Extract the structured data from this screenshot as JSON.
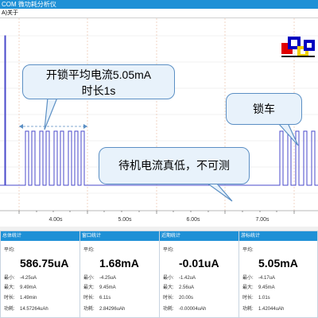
{
  "window": {
    "title": "COM 微功耗分析仪"
  },
  "menu": {
    "about": "A)关于"
  },
  "chart_data": {
    "type": "line",
    "xlabel": "",
    "ylabel": "",
    "x_ticks": [
      "4.00s",
      "5.00s",
      "6.00s",
      "7.00s"
    ],
    "annotations": {
      "callout_unlock_line1": "开锁平均电流5.05mA",
      "callout_unlock_line2": "时长1s",
      "callout_standby": "待机电流真低，不可测",
      "callout_lock": "锁车"
    }
  },
  "panels": [
    {
      "title": "总体统计",
      "avg_label": "平均:",
      "avg_value": "586.75uA",
      "rows": [
        {
          "label": "最小:",
          "value": "-4.25uA"
        },
        {
          "label": "最大:",
          "value": "9.49mA"
        },
        {
          "label": "时长:",
          "value": "1.49min"
        },
        {
          "label": "功耗:",
          "value": "14.57264uAh"
        }
      ]
    },
    {
      "title": "窗口统计",
      "avg_label": "平均:",
      "avg_value": "1.68mA",
      "rows": [
        {
          "label": "最小:",
          "value": "-4.25uA"
        },
        {
          "label": "最大:",
          "value": "9.45mA"
        },
        {
          "label": "时长:",
          "value": "6.11s"
        },
        {
          "label": "功耗:",
          "value": "2.84296uAh"
        }
      ]
    },
    {
      "title": "近期统计",
      "avg_label": "平均:",
      "avg_value": "-0.01uA",
      "rows": [
        {
          "label": "最小:",
          "value": "-1.42uA"
        },
        {
          "label": "最大:",
          "value": "2.56uA"
        },
        {
          "label": "时长:",
          "value": "20.00s"
        },
        {
          "label": "功耗:",
          "value": "-0.00004uAh"
        }
      ]
    },
    {
      "title": "游标统计",
      "avg_label": "平均:",
      "avg_value": "5.05mA",
      "rows": [
        {
          "label": "最小:",
          "value": "-4.17uA"
        },
        {
          "label": "最大:",
          "value": "9.45mA"
        },
        {
          "label": "时长:",
          "value": "1.01s"
        },
        {
          "label": "功耗:",
          "value": "1.42044uAh"
        }
      ]
    }
  ]
}
